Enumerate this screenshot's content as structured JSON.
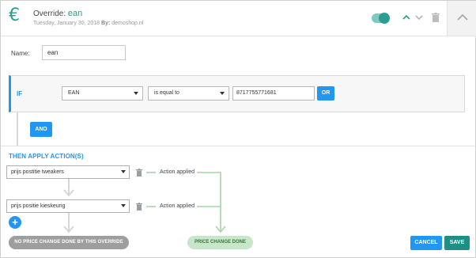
{
  "header": {
    "prefix": "Override:",
    "name": "ean",
    "date": "Tuesday, January 30, 2018",
    "by_label": "By:",
    "author": "demoshop.nl",
    "toggle_on": true
  },
  "name_field": {
    "label": "Name:",
    "value": "ean"
  },
  "condition": {
    "if_label": "IF",
    "field": "EAN",
    "operator": "is equal to",
    "value": "8717755771681",
    "or_label": "OR",
    "and_label": "AND"
  },
  "actions": {
    "title": "THEN APPLY ACTION(S)",
    "items": [
      {
        "select": "prijs postitie tweakers",
        "status": "Action applied"
      },
      {
        "select": "prijs positie kieskeurig",
        "status": "Action applied"
      }
    ],
    "add_label": "+"
  },
  "results": {
    "no_change": "NO PRICE CHANGE DONE BY THIS OVERRIDE",
    "price_change": "PRICE CHANGE DONE"
  },
  "footer": {
    "cancel": "CANCEL",
    "save": "SAVE"
  },
  "colors": {
    "accent": "#2a9d8f",
    "primary": "#2196f3",
    "flow": "#a5d6a7",
    "save": "#1e8f85"
  }
}
